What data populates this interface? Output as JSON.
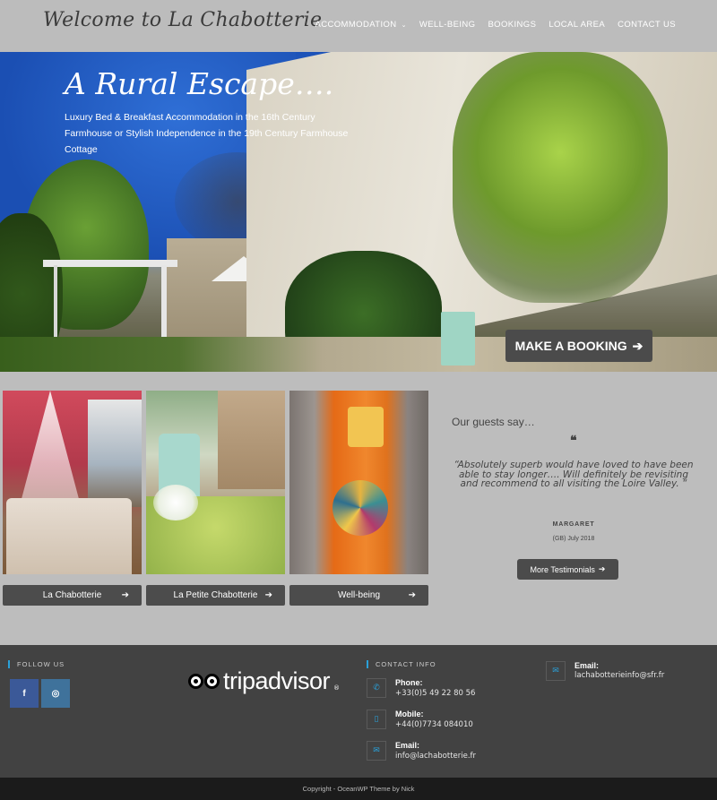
{
  "header": {
    "logo": "Welcome to La Chabotterie",
    "nav": [
      {
        "label": "ACCOMMODATION",
        "has_dropdown": true
      },
      {
        "label": "WELL-BEING"
      },
      {
        "label": "BOOKINGS"
      },
      {
        "label": "LOCAL AREA"
      },
      {
        "label": "CONTACT US"
      }
    ]
  },
  "hero": {
    "title": "A Rural Escape….",
    "subtitle": "Luxury Bed & Breakfast Accommodation in the 16th Century Farmhouse or Stylish Independence in the 19th Century Farmhouse Cottage",
    "booking_button": "MAKE A BOOKING"
  },
  "rooms": [
    {
      "label": "La Chabotterie"
    },
    {
      "label": "La Petite Chabotterie"
    },
    {
      "label": "Well-being"
    }
  ],
  "testimonials": {
    "title": "Our guests say…",
    "quote": "“Absolutely superb would have loved to have been able to stay longer…. Will definitely be revisiting and recommend to all visiting the Loire Valley. “",
    "author": "MARGARET",
    "date": "(GB) July 2018",
    "more_button": "More Testimonials"
  },
  "footer": {
    "follow_heading": "FOLLOW US",
    "social": [
      {
        "icon": "facebook-icon",
        "glyph": "f",
        "color": "#3b5998"
      },
      {
        "icon": "instagram-icon",
        "glyph": "◎",
        "color": "#3f729b"
      }
    ],
    "tripadvisor": {
      "text": "tripadvisor",
      "reg": "®"
    },
    "contact_heading": "CONTACT INFO",
    "contacts": [
      {
        "label": "Phone:",
        "value": "+33(0)5 49 22 80 56",
        "icon": "phone-icon"
      },
      {
        "label": "Mobile:",
        "value": "+44(0)7734 084010",
        "icon": "mobile-icon"
      },
      {
        "label": "Email:",
        "value": "info@lachabotterie.fr",
        "icon": "envelope-icon"
      }
    ],
    "email2": {
      "label": "Email:",
      "value": "lachabotterieinfo@sfr.fr",
      "icon": "envelope-icon"
    },
    "copyright": "Copyright - OceanWP Theme by Nick"
  },
  "colors": {
    "background": "#bdbdbd",
    "button": "#4b4b4b",
    "footer": "#424242",
    "accent": "#2aa0d8"
  }
}
